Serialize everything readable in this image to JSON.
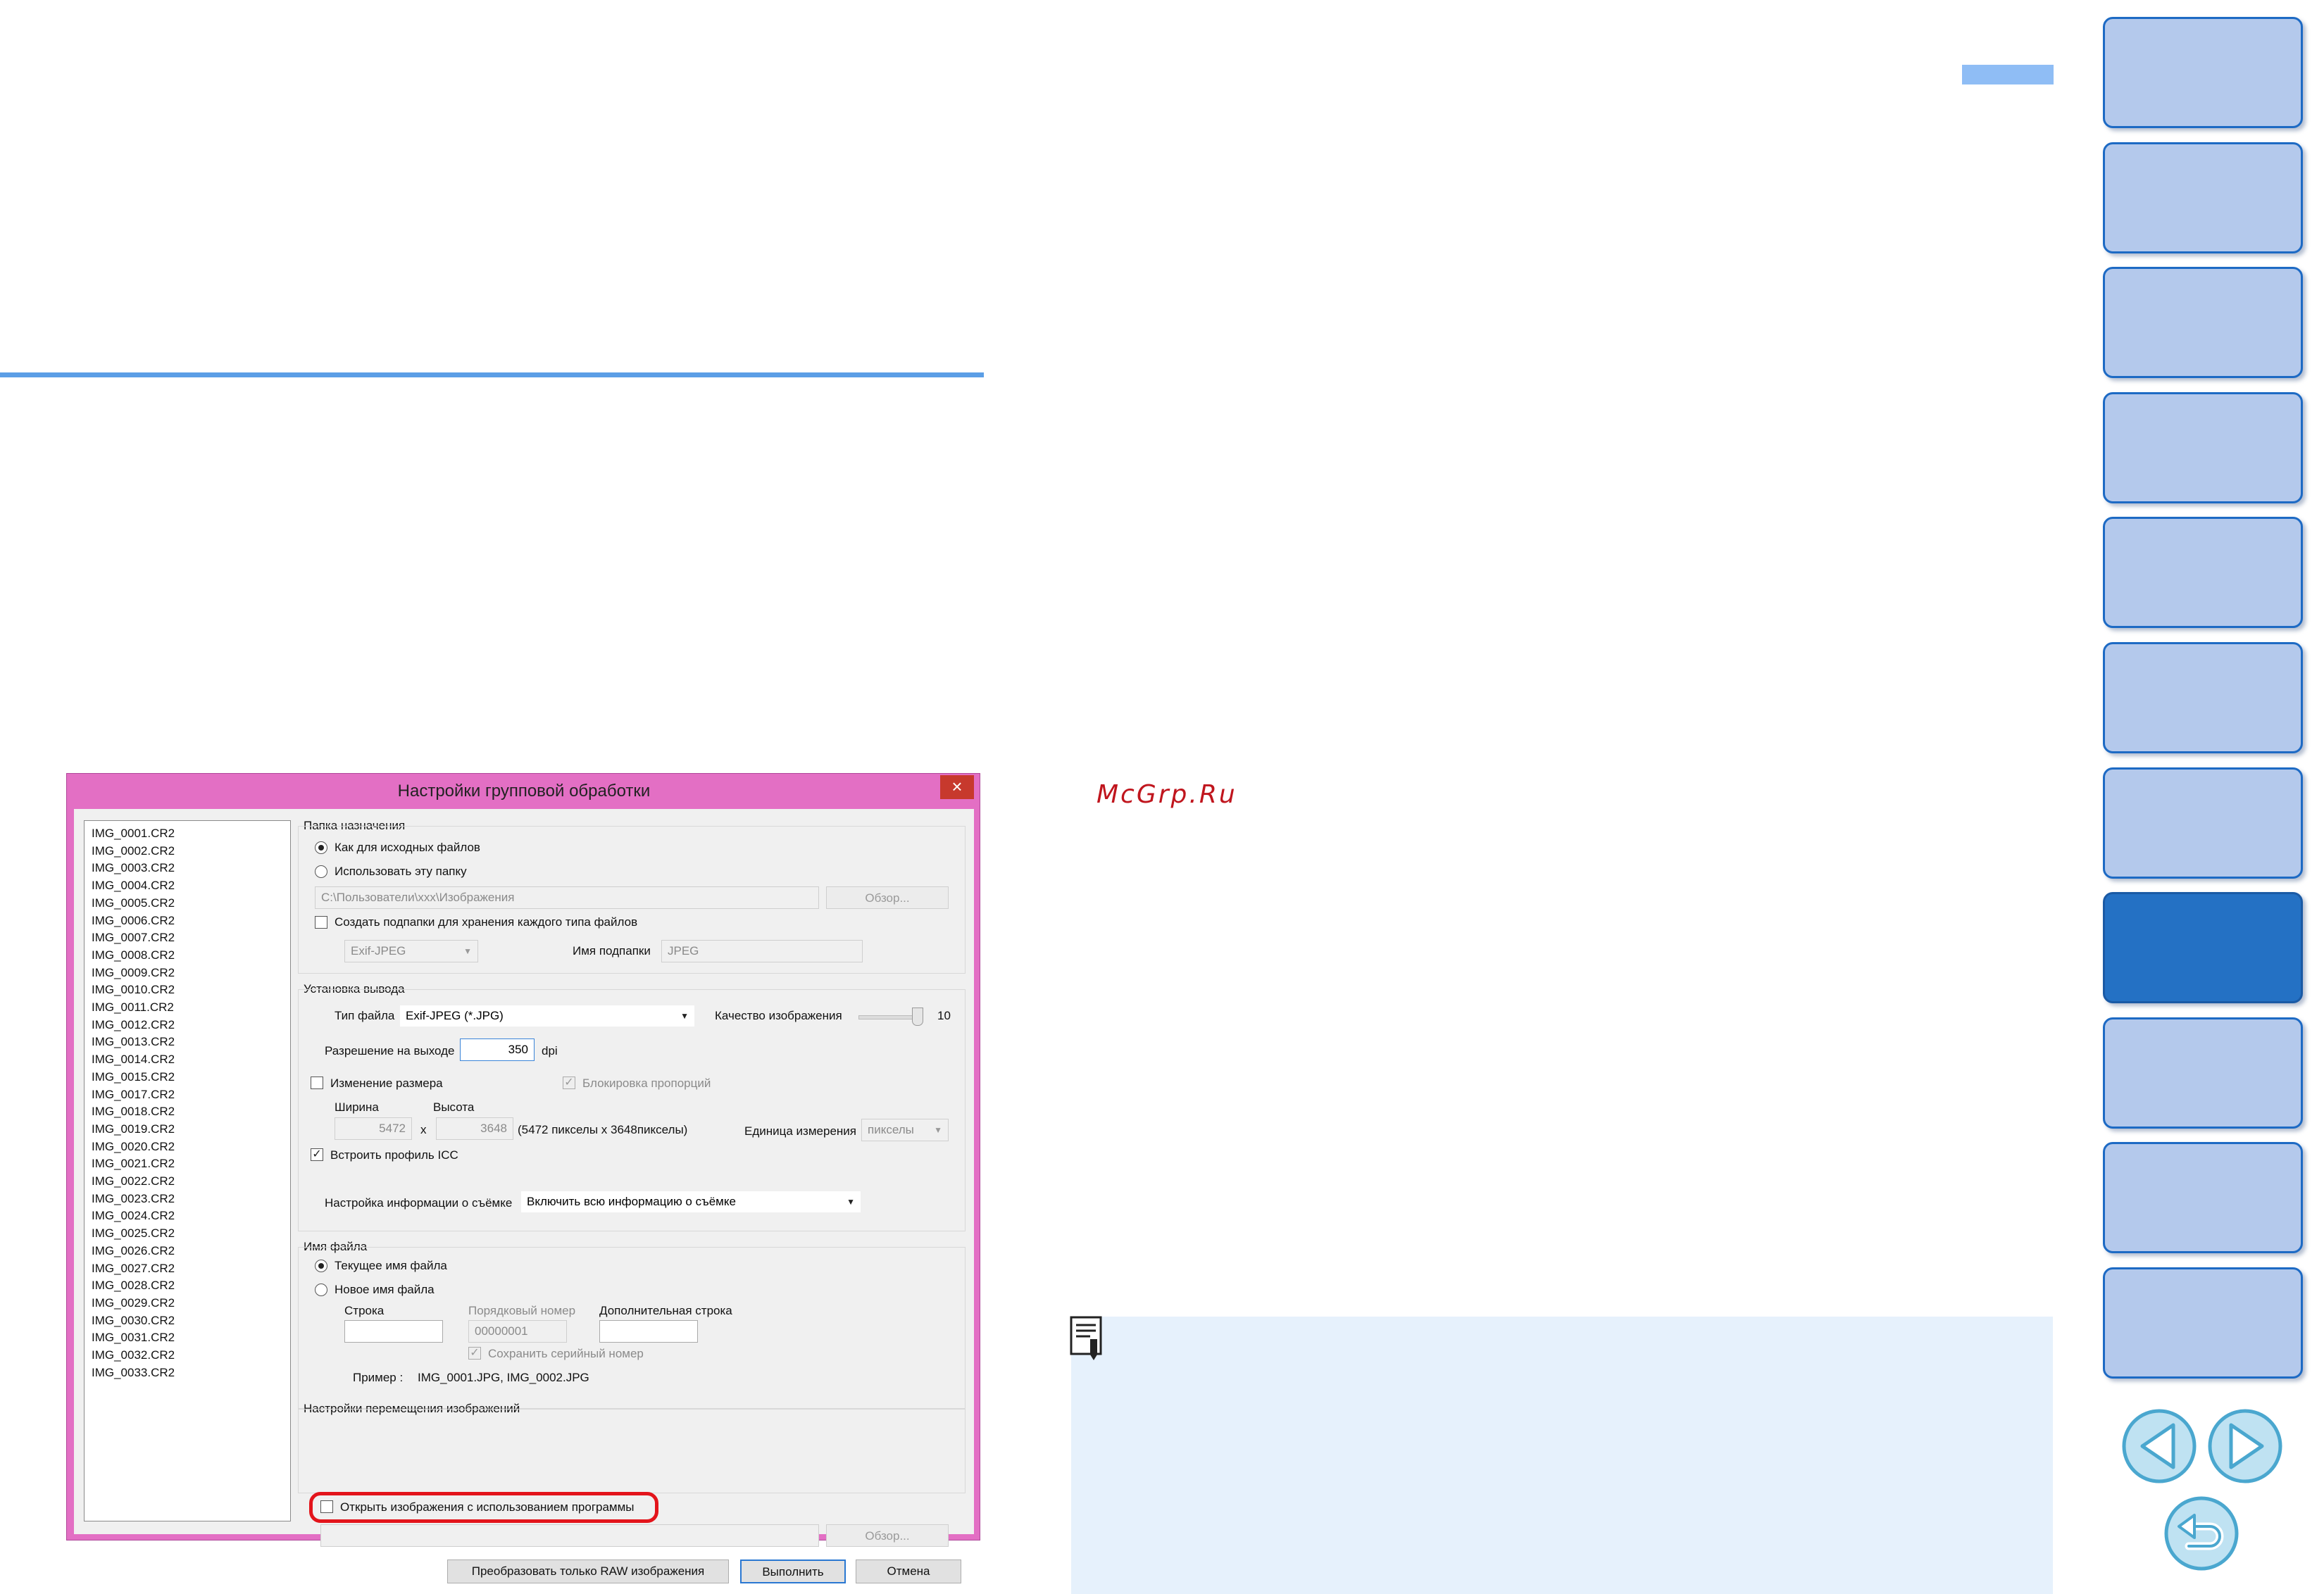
{
  "watermark": "McGrp.Ru",
  "side_tabs": [
    {
      "name": "side-tab-1",
      "active": false
    },
    {
      "name": "side-tab-2",
      "active": false
    },
    {
      "name": "side-tab-3",
      "active": false
    },
    {
      "name": "side-tab-4",
      "active": false
    },
    {
      "name": "side-tab-5",
      "active": false
    },
    {
      "name": "side-tab-6",
      "active": false
    },
    {
      "name": "side-tab-7",
      "active": false
    },
    {
      "name": "side-tab-8",
      "active": true
    },
    {
      "name": "side-tab-9",
      "active": false
    },
    {
      "name": "side-tab-10",
      "active": false
    },
    {
      "name": "side-tab-11",
      "active": false
    }
  ],
  "colors": {
    "accent": "#2471c4",
    "tab": "#b4c9ec",
    "title_bar": "#e36fc4",
    "highlight": "#e3141b",
    "note_bg": "#e6f1fc"
  },
  "dialog": {
    "title": "Настройки групповой обработки",
    "close": "×",
    "files": [
      "IMG_0001.CR2",
      "IMG_0002.CR2",
      "IMG_0003.CR2",
      "IMG_0004.CR2",
      "IMG_0005.CR2",
      "IMG_0006.CR2",
      "IMG_0007.CR2",
      "IMG_0008.CR2",
      "IMG_0009.CR2",
      "IMG_0010.CR2",
      "IMG_0011.CR2",
      "IMG_0012.CR2",
      "IMG_0013.CR2",
      "IMG_0014.CR2",
      "IMG_0015.CR2",
      "IMG_0017.CR2",
      "IMG_0018.CR2",
      "IMG_0019.CR2",
      "IMG_0020.CR2",
      "IMG_0021.CR2",
      "IMG_0022.CR2",
      "IMG_0023.CR2",
      "IMG_0024.CR2",
      "IMG_0025.CR2",
      "IMG_0026.CR2",
      "IMG_0027.CR2",
      "IMG_0028.CR2",
      "IMG_0029.CR2",
      "IMG_0030.CR2",
      "IMG_0031.CR2",
      "IMG_0032.CR2",
      "IMG_0033.CR2"
    ],
    "destination": {
      "title": "Папка назначения",
      "same_as_source": "Как для исходных файлов",
      "use_folder": "Использовать эту папку",
      "path": "C:\\Пользователи\\ххх\\Изображения",
      "browse": "Обзор...",
      "subfolders": "Создать подпапки для хранения каждого типа файлов",
      "subfolder_type": "Exif-JPEG",
      "subfolder_name_label": "Имя подпапки",
      "subfolder_name": "JPEG"
    },
    "output": {
      "title": "Установка вывода",
      "file_type_label": "Тип файла",
      "file_type": "Exif-JPEG (*.JPG)",
      "quality_label": "Качество изображения",
      "quality": "10",
      "resolution_label": "Разрешение на выходе",
      "resolution": "350",
      "dpi": "dpi",
      "resize": "Изменение размера",
      "lock_ratio": "Блокировка пропорций",
      "width_label": "Ширина",
      "height_label": "Высота",
      "width": "5472",
      "x": "x",
      "height": "3648",
      "size_info": "(5472 пикселы x 3648пикселы)",
      "unit_label": "Единица измерения",
      "unit": "пикселы",
      "embed_icc": "Встроить профиль ICC",
      "shooting_info_label": "Настройка информации о съёмке",
      "shooting_info": "Включить всю информацию о съёмке"
    },
    "filename": {
      "title": "Имя файла",
      "current": "Текущее имя файла",
      "new": "Новое имя файла",
      "string_label": "Строка",
      "serial_label": "Порядковый номер",
      "serial": "00000001",
      "extra_label": "Дополнительная строка",
      "keep_serial": "Сохранить серийный номер",
      "example_label": "Пример :",
      "example": "IMG_0001.JPG, IMG_0002.JPG"
    },
    "transfer": {
      "title": "Настройки перемещения изображений",
      "open_with": "Открыть изображения с использованием программы",
      "browse": "Обзор..."
    },
    "buttons": {
      "raw_only": "Преобразовать только RAW изображения",
      "execute": "Выполнить",
      "cancel": "Отмена"
    }
  }
}
